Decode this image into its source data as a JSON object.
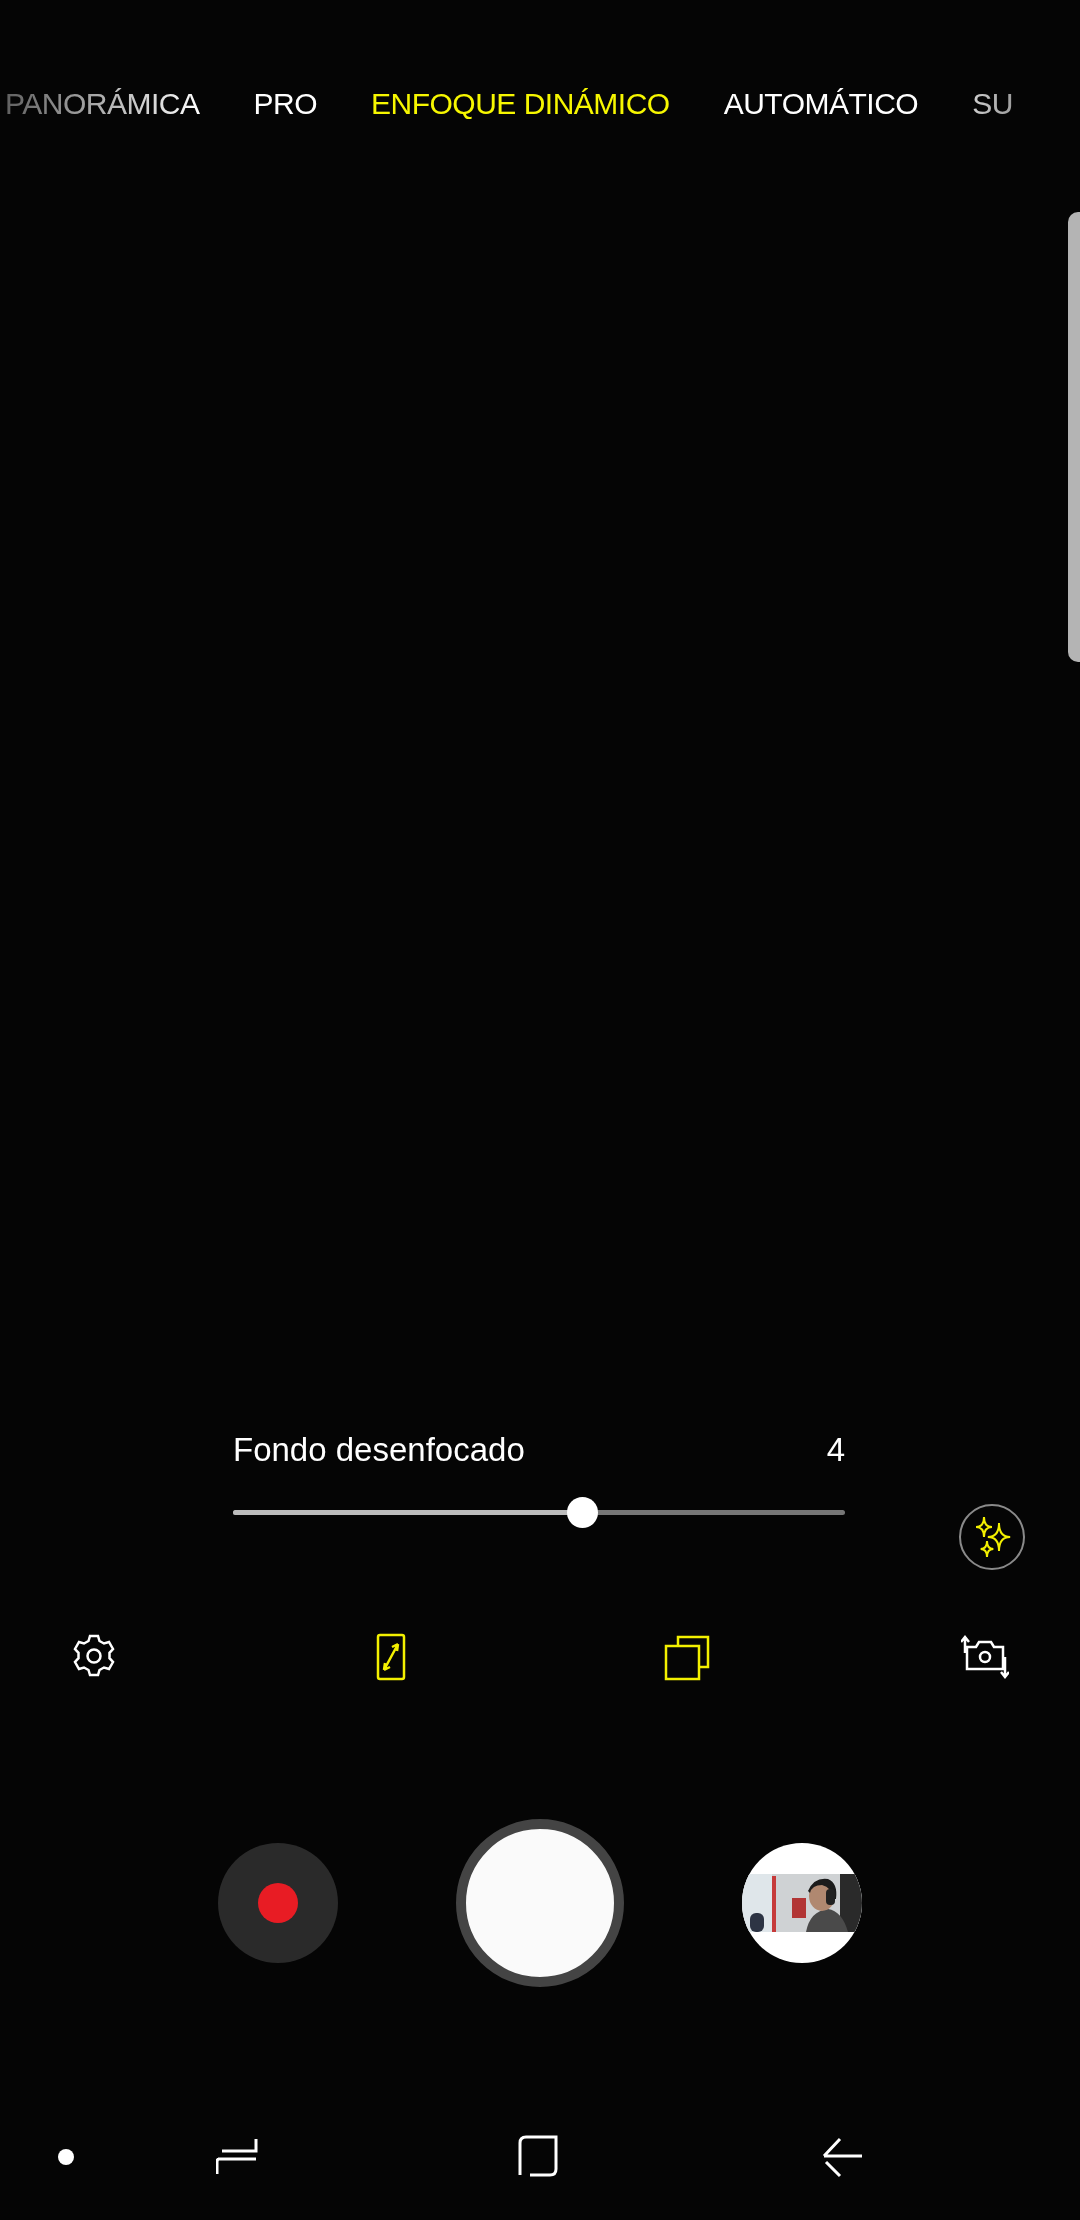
{
  "modes": [
    {
      "label": "PANORÁMICA",
      "selected": false
    },
    {
      "label": "PRO",
      "selected": false
    },
    {
      "label": "ENFOQUE DINÁMICO",
      "selected": true
    },
    {
      "label": "AUTOMÁTICO",
      "selected": false
    },
    {
      "label": "SU",
      "selected": false
    }
  ],
  "blur_slider": {
    "label": "Fondo desenfocado",
    "value": "4",
    "level": 0.57
  },
  "effects_button": {
    "on": true
  },
  "toolbar": [
    {
      "kind": "settings",
      "on": false
    },
    {
      "kind": "ratio",
      "on": true
    },
    {
      "kind": "multi",
      "on": true
    },
    {
      "kind": "switch",
      "on": false
    }
  ],
  "capture": {
    "recording": false
  },
  "nav": [
    {
      "kind": "dot"
    },
    {
      "kind": "recents"
    },
    {
      "kind": "home"
    },
    {
      "kind": "back"
    }
  ]
}
